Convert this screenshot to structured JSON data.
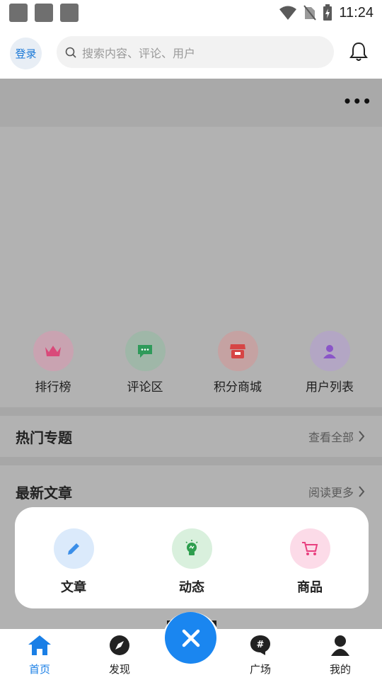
{
  "status_bar": {
    "time": "11:24",
    "icons": [
      "notification-square-icon",
      "notification-square-icon",
      "notification-square-icon",
      "wifi-icon",
      "no-sim-icon",
      "battery-charging-icon"
    ]
  },
  "header": {
    "login_label": "登录",
    "search_placeholder": "搜索内容、评论、用户",
    "icons": {
      "search": "search-icon",
      "notifications": "bell-icon"
    }
  },
  "banner": {
    "more_icon": "more-dots-icon"
  },
  "quick_links": [
    {
      "label": "排行榜",
      "icon": "crown-icon",
      "color": "#d94a7a"
    },
    {
      "label": "评论区",
      "icon": "chat-icon",
      "color": "#2f9a5a"
    },
    {
      "label": "积分商城",
      "icon": "shop-icon",
      "color": "#d64545"
    },
    {
      "label": "用户列表",
      "icon": "user-icon",
      "color": "#8a55c8"
    }
  ],
  "sections": {
    "hot_topics": {
      "title": "热门专题",
      "link": "查看全部"
    },
    "latest_articles": {
      "title": "最新文章",
      "link": "阅读更多"
    }
  },
  "popup": {
    "items": [
      {
        "label": "文章",
        "icon": "pencil-icon",
        "color": "#3b8ee8",
        "bg": "#dbeafb"
      },
      {
        "label": "动态",
        "icon": "lightbulb-icon",
        "color": "#2e9e4e",
        "bg": "#d9f0dd"
      },
      {
        "label": "商品",
        "icon": "cart-icon",
        "color": "#e8407f",
        "bg": "#fcdbe8"
      }
    ]
  },
  "bottom_nav": {
    "items": [
      {
        "label": "首页",
        "icon": "home-icon",
        "active": true
      },
      {
        "label": "发现",
        "icon": "compass-icon",
        "active": false
      },
      {
        "label": "广场",
        "icon": "hashtag-icon",
        "active": false
      },
      {
        "label": "我的",
        "icon": "person-icon",
        "active": false
      }
    ],
    "fab_icon": "close-icon"
  },
  "colors": {
    "accent": "#1a86f0",
    "active_tab": "#1a7fe6",
    "overlay": "#b2b2b2"
  }
}
